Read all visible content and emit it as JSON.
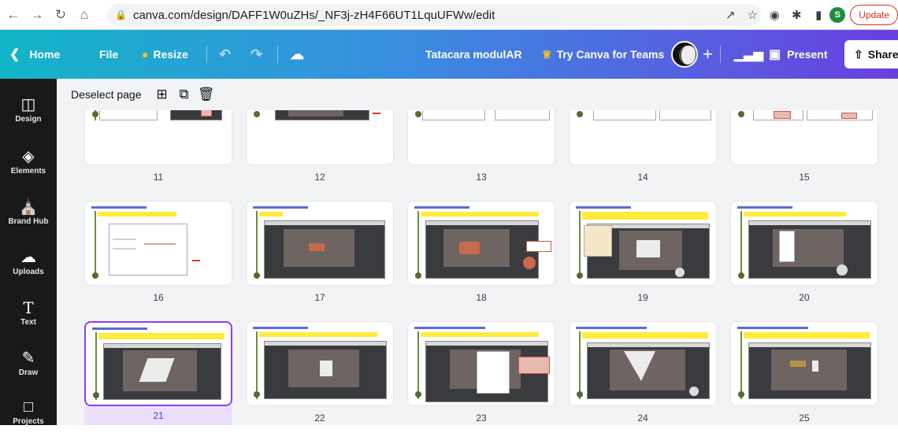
{
  "browser": {
    "url": "canva.com/design/DAFF1W0uZHs/_NF3j-zH4F66UT1LquUFWw/edit",
    "profile_initial": "S",
    "update_label": "Update"
  },
  "toolbar": {
    "home": "Home",
    "file": "File",
    "resize": "Resize",
    "title": "Tatacara modulAR",
    "try_teams": "Try Canva for Teams",
    "present": "Present",
    "share": "Share"
  },
  "sidebar": {
    "items": [
      {
        "label": "Design",
        "icon": "design-icon"
      },
      {
        "label": "Elements",
        "icon": "elements-icon"
      },
      {
        "label": "Brand Hub",
        "icon": "brand-hub-icon"
      },
      {
        "label": "Uploads",
        "icon": "uploads-icon"
      },
      {
        "label": "Text",
        "icon": "text-icon"
      },
      {
        "label": "Draw",
        "icon": "draw-icon"
      },
      {
        "label": "Projects",
        "icon": "projects-icon"
      }
    ]
  },
  "pagebar": {
    "deselect": "Deselect page"
  },
  "pages": {
    "row1": [
      "11",
      "12",
      "13",
      "14",
      "15"
    ],
    "row2": [
      "16",
      "17",
      "18",
      "19",
      "20"
    ],
    "row3": [
      "21",
      "22",
      "23",
      "24",
      "25"
    ],
    "selected": "21"
  },
  "colors": {
    "accent": "#8b3dff",
    "sidebar_bg": "#18191b",
    "highlight": "#ffeb3b"
  }
}
